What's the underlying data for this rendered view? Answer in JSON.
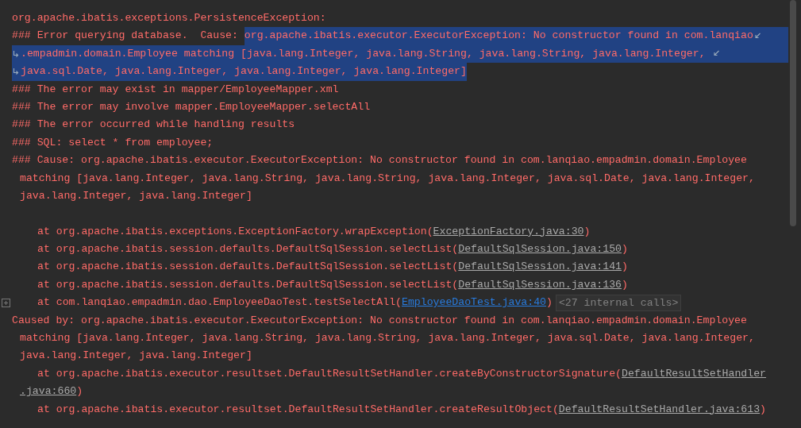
{
  "console": {
    "lines": [
      {
        "kind": "plain",
        "segments": [
          {
            "kind": "text",
            "text": "org.apache.ibatis.exceptions.PersistenceException:",
            "selected": false
          }
        ]
      },
      {
        "kind": "plain",
        "wrap_end": true,
        "segments": [
          {
            "kind": "text",
            "text": "### Error querying database.  Cause: ",
            "selected": false
          },
          {
            "kind": "text",
            "text": "org.apache.ibatis.executor.ExecutorException: No constructor found in com.lanqiao",
            "selected": true
          }
        ]
      },
      {
        "kind": "plain",
        "wrap_start": true,
        "wrap_end": true,
        "segments": [
          {
            "kind": "text",
            "text": ".empadmin.domain.Employee matching [java.lang.Integer, java.lang.String, java.lang.String, java.lang.Integer, ",
            "selected": true
          }
        ]
      },
      {
        "kind": "plain",
        "wrap_start": true,
        "segments": [
          {
            "kind": "text",
            "text": "java.sql.Date, java.lang.Integer, java.lang.Integer, java.lang.Integer]",
            "selected": true
          }
        ]
      },
      {
        "kind": "plain",
        "segments": [
          {
            "kind": "text",
            "text": "### The error may exist in mapper/EmployeeMapper.xml",
            "selected": false
          }
        ]
      },
      {
        "kind": "plain",
        "segments": [
          {
            "kind": "text",
            "text": "### The error may involve mapper.EmployeeMapper.selectAll",
            "selected": false
          }
        ]
      },
      {
        "kind": "plain",
        "segments": [
          {
            "kind": "text",
            "text": "### The error occurred while handling results",
            "selected": false
          }
        ]
      },
      {
        "kind": "plain",
        "segments": [
          {
            "kind": "text",
            "text": "### SQL: select * from employee;",
            "selected": false
          }
        ]
      },
      {
        "kind": "plain",
        "segments": [
          {
            "kind": "text",
            "text": "### Cause: org.apache.ibatis.executor.ExecutorException: No constructor found in com.lanqiao.empadmin.domain.Employee",
            "selected": false
          }
        ]
      },
      {
        "kind": "continuation",
        "segments": [
          {
            "kind": "text",
            "text": "matching [java.lang.Integer, java.lang.String, java.lang.String, java.lang.Integer, java.sql.Date, java.lang.Integer,",
            "selected": false
          }
        ]
      },
      {
        "kind": "continuation",
        "segments": [
          {
            "kind": "text",
            "text": "java.lang.Integer, java.lang.Integer]",
            "selected": false
          }
        ]
      },
      {
        "kind": "blank"
      },
      {
        "kind": "frame",
        "segments": [
          {
            "kind": "text",
            "text": "at org.apache.ibatis.exceptions.ExceptionFactory.wrapException(",
            "selected": false
          },
          {
            "kind": "link",
            "text": "ExceptionFactory.java:30",
            "selected": false
          },
          {
            "kind": "text",
            "text": ")",
            "selected": false
          }
        ]
      },
      {
        "kind": "frame",
        "segments": [
          {
            "kind": "text",
            "text": "at org.apache.ibatis.session.defaults.DefaultSqlSession.selectList(",
            "selected": false
          },
          {
            "kind": "link",
            "text": "DefaultSqlSession.java:150",
            "selected": false
          },
          {
            "kind": "text",
            "text": ")",
            "selected": false
          }
        ]
      },
      {
        "kind": "frame",
        "segments": [
          {
            "kind": "text",
            "text": "at org.apache.ibatis.session.defaults.DefaultSqlSession.selectList(",
            "selected": false
          },
          {
            "kind": "link",
            "text": "DefaultSqlSession.java:141",
            "selected": false
          },
          {
            "kind": "text",
            "text": ")",
            "selected": false
          }
        ]
      },
      {
        "kind": "frame",
        "segments": [
          {
            "kind": "text",
            "text": "at org.apache.ibatis.session.defaults.DefaultSqlSession.selectList(",
            "selected": false
          },
          {
            "kind": "link",
            "text": "DefaultSqlSession.java:136",
            "selected": false
          },
          {
            "kind": "text",
            "text": ")",
            "selected": false
          }
        ]
      },
      {
        "kind": "frame",
        "foldable": true,
        "segments": [
          {
            "kind": "text",
            "text": "at com.lanqiao.empadmin.dao.EmployeeDaoTest.testSelectAll(",
            "selected": false
          },
          {
            "kind": "project_link",
            "text": "EmployeeDaoTest.java:40",
            "selected": false
          },
          {
            "kind": "text",
            "text": ")",
            "selected": false
          },
          {
            "kind": "hint",
            "text": "<27 internal calls>",
            "selected": false
          }
        ]
      },
      {
        "kind": "plain",
        "segments": [
          {
            "kind": "text",
            "text": "Caused by: org.apache.ibatis.executor.ExecutorException: No constructor found in com.lanqiao.empadmin.domain.Employee",
            "selected": false
          }
        ]
      },
      {
        "kind": "continuation",
        "segments": [
          {
            "kind": "text",
            "text": "matching [java.lang.Integer, java.lang.String, java.lang.String, java.lang.Integer, java.sql.Date, java.lang.Integer,",
            "selected": false
          }
        ]
      },
      {
        "kind": "continuation",
        "segments": [
          {
            "kind": "text",
            "text": "java.lang.Integer, java.lang.Integer]",
            "selected": false
          }
        ]
      },
      {
        "kind": "frame",
        "segments": [
          {
            "kind": "text",
            "text": "at org.apache.ibatis.executor.resultset.DefaultResultSetHandler.createByConstructorSignature(",
            "selected": false
          },
          {
            "kind": "link",
            "text": "DefaultResultSetHandler",
            "selected": false
          }
        ]
      },
      {
        "kind": "continuation",
        "segments": [
          {
            "kind": "link",
            "text": ".java:660",
            "selected": false
          },
          {
            "kind": "text",
            "text": ")",
            "selected": false
          }
        ]
      },
      {
        "kind": "frame",
        "segments": [
          {
            "kind": "text",
            "text": "at org.apache.ibatis.executor.resultset.DefaultResultSetHandler.createResultObject(",
            "selected": false
          },
          {
            "kind": "link",
            "text": "DefaultResultSetHandler.java:613",
            "selected": false
          },
          {
            "kind": "text",
            "text": ")",
            "selected": false
          }
        ]
      }
    ]
  }
}
